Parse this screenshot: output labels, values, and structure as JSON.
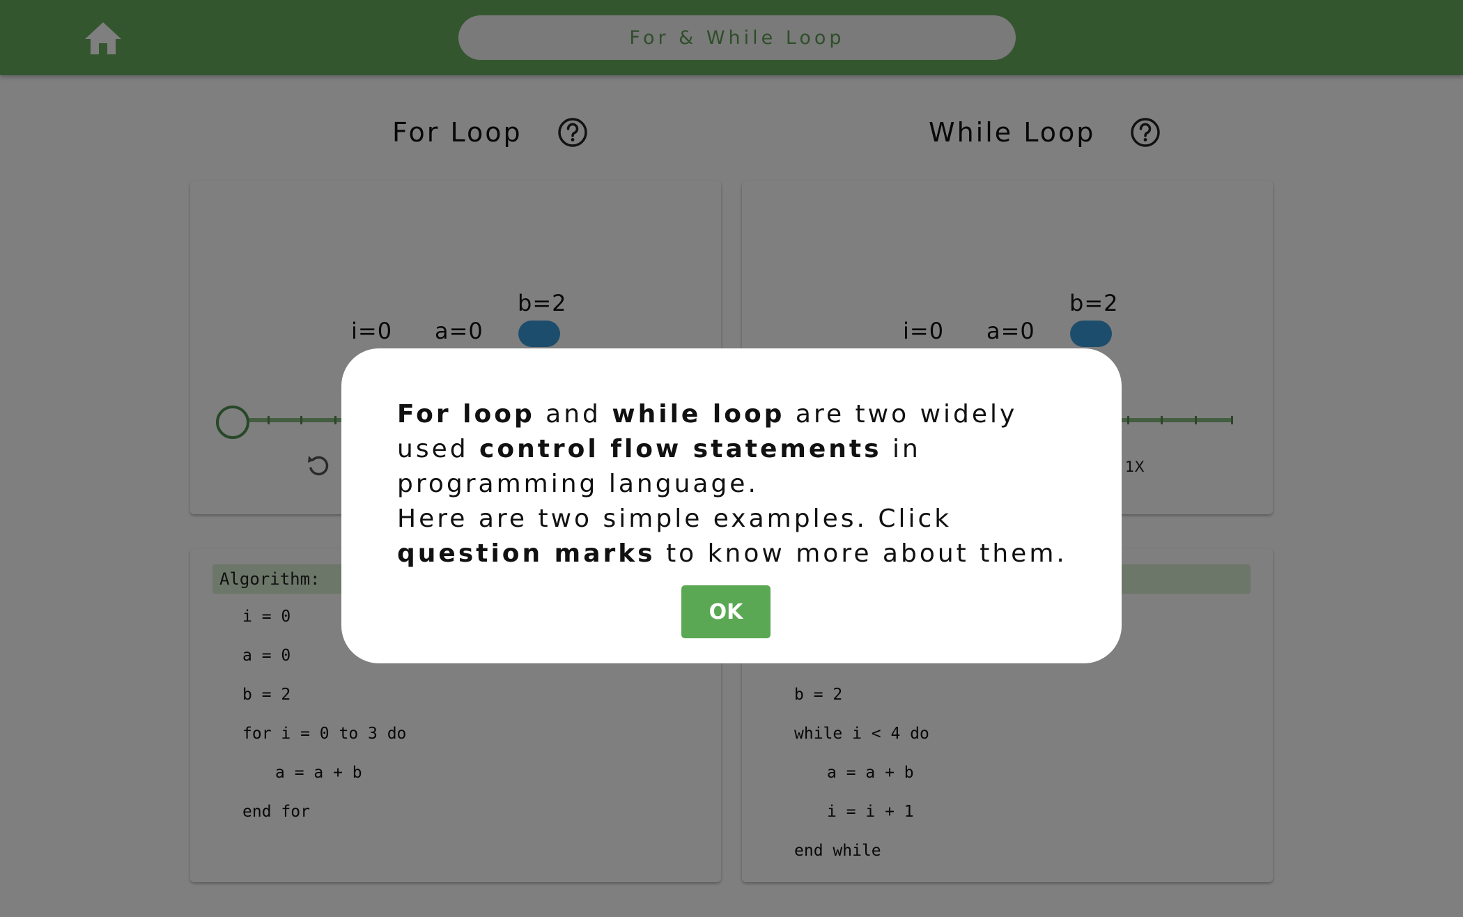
{
  "header": {
    "home_icon": "home-icon",
    "title": "For & While Loop",
    "accent_color": "#69ad5e"
  },
  "for_section": {
    "title": "For Loop",
    "help_icon": "question-circle-icon",
    "vars": {
      "i": "i=0",
      "a": "a=0",
      "b": "b=2"
    },
    "controls": {
      "reset_icon": "reset-icon"
    },
    "algorithm": {
      "header": "Algorithm:",
      "lines": [
        "i = 0",
        "a = 0",
        "b = 2",
        "for i = 0 to 3 do",
        "a = a + b",
        "end for"
      ]
    }
  },
  "while_section": {
    "title": "While Loop",
    "help_icon": "question-circle-icon",
    "vars": {
      "i": "i=0",
      "a": "a=0",
      "b": "b=2"
    },
    "controls": {
      "speed": "1X"
    },
    "algorithm": {
      "lines": [
        "b = 2",
        "while i < 4 do",
        "a = a + b",
        "i = i + 1",
        "end while"
      ]
    }
  },
  "modal": {
    "p1": {
      "t1": "For loop",
      "t2": " and ",
      "t3": "while loop",
      "t4": " are two widely used ",
      "t5": "control flow statements",
      "t6": " in programming language."
    },
    "p2": {
      "t1": "Here are two simple examples. Click ",
      "t2": "question marks",
      "t3": " to know more about them."
    },
    "ok_label": "OK",
    "ok_color": "#5aa853"
  }
}
